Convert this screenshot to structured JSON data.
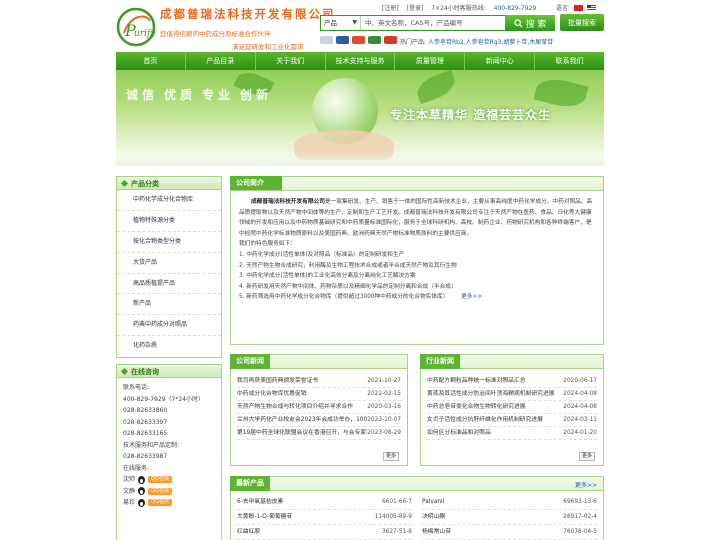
{
  "header": {
    "company_name": "成都普瑞法科技开发有限公司",
    "slogan_1": "您值得信赖的中药成分及标准合作伙伴",
    "slogan_2": "满足您研发和工业化需求",
    "toplinks": {
      "register": "[注册]",
      "login": "[登录]",
      "service_hours": "7×24小时客服热线:",
      "phone": "400-829-7929",
      "language": "语言:"
    },
    "search": {
      "type": "产品",
      "placeholder": "中、英文名称，CAS号，产品编号",
      "button": "搜 索",
      "bulk": "批量搜索"
    },
    "hot_label": "热门产品:",
    "hot_items": "人参皂苷Rb2,人参皂苷Rg3,胡萝卜苷,木犀草苷"
  },
  "nav": [
    "首页",
    "产品目录",
    "关于我们",
    "技术支持与服务",
    "质量管理",
    "新闻中心",
    "联系我们"
  ],
  "banner": {
    "words": [
      "诚信",
      "优质",
      "专业",
      "创新"
    ],
    "tagline": "专注本草精华  造福芸芸众生"
  },
  "categories": {
    "title": "产品分类",
    "items": [
      "中药化学成分化合物库",
      "植物特殊源分类",
      "按化合物类型分类",
      "大货产品",
      "高品质植提产品",
      "新产品",
      "药典中药成分对照品",
      "化药杂质"
    ]
  },
  "consult": {
    "title": "在线咨询",
    "lines": [
      "联系电话:",
      "400-829-7929（7*24小时）",
      "028-82633860",
      "028-82633397",
      "028-82633165",
      "技术服务和产品定制:",
      "028-82633987",
      "在线服务:"
    ],
    "staff": [
      "沈帅",
      "文静",
      "易珍"
    ],
    "qq_label": "QQ在线"
  },
  "about": {
    "title": "公司简介",
    "company_bold": "成都普瑞法科技开发有限公司",
    "intro": "是一家集研发、生产、销售于一体的国际性高新技术企业，主要从事高纯度中药化学成分、中药对照品、高品质提取物以及天然产物中间体等的生产、定制和生产工艺开发。成都普瑞法科技开发有限公司专注于天然产物在医药、食品、日化等大健康领域的开发和应用以及中药物质基础研究和中药质量标准国际化，服务于全球科研机构、高校、制药企业、药物研究机构和各种终端客户，是中检院中药化学标准物质原料以及美国药典、欧洲药典天然产物标准物质原料的主要供应商。",
    "services_label": "我们的特色服务如下：",
    "services": [
      "1. 中药化学成分(活性单体)及对照品（标准品）的定制研发和生产",
      "2. 天然产物生物合成研究，利用酶及生物工程技术合成或者半合成天然产物及其衍生物",
      "3. 中药化学成分(活性单体)的工业化高效分离及分离纯化工艺解决方案",
      "4. 新药研发用天然产物中间体、药物杂质以及精细化学品的定制分离和合成（半合成）",
      "5. 新药筛选用中药化学成分化合物库（提供超过3000种中药成分的化合物实体库）"
    ],
    "more": "更多>>"
  },
  "company_news": {
    "title": "公司新闻",
    "items": [
      {
        "t": "我司再获美国药典颁发荣誉证书",
        "d": "2021-10-27"
      },
      {
        "t": "中药成分化合物库优惠促销",
        "d": "2022-02-15"
      },
      {
        "t": "天然产物生物合成与转化项目介绍并寻求合作",
        "d": "2020-03-16"
      },
      {
        "t": "兰州大学药化产业校友会2023年会成功举办，100...",
        "d": "2023-10-07"
      },
      {
        "t": "第19届中药全球化联盟会议在香港召开，与会专家教...",
        "d": "2023-08-29"
      }
    ],
    "more": "更多"
  },
  "industry_news": {
    "title": "行业新闻",
    "items": [
      {
        "t": "中药配方颗粒品种统一标准对照品汇总",
        "d": "2020-06-17"
      },
      {
        "t": "黄芪及其活性成分防治间叶顶海鞘病机制研究进展",
        "d": "2024-04-08"
      },
      {
        "t": "中药总皂苷类化合物生物转化研究进展",
        "d": "2024-04-08"
      },
      {
        "t": "女贞子活性成分抗肝纤维化作用机制研究进展",
        "d": "2024-03-11"
      },
      {
        "t": "如何区分标准品和对照品",
        "d": "2024-01-20"
      }
    ],
    "more": "更多"
  },
  "new_products": {
    "title": "最新产品",
    "more": "更多>>",
    "items": [
      {
        "n": "6-去甲氧基桔皮素",
        "c": "6601-66-7"
      },
      {
        "n": "Palvanil",
        "c": "69693-13-6"
      },
      {
        "n": "大黄酚-1-O-葡萄糖苷",
        "c": "114005-89-9"
      },
      {
        "n": "决明山酮",
        "c": "28917-02-4"
      },
      {
        "n": "红曲红胺",
        "c": "3627-51-8"
      },
      {
        "n": "杨梅常山苷",
        "c": "76076-04-5"
      }
    ]
  },
  "colors": {
    "brand_green": "#3a9a1c",
    "brand_orange": "#ea6a19",
    "link_blue": "#1c5ea5"
  }
}
